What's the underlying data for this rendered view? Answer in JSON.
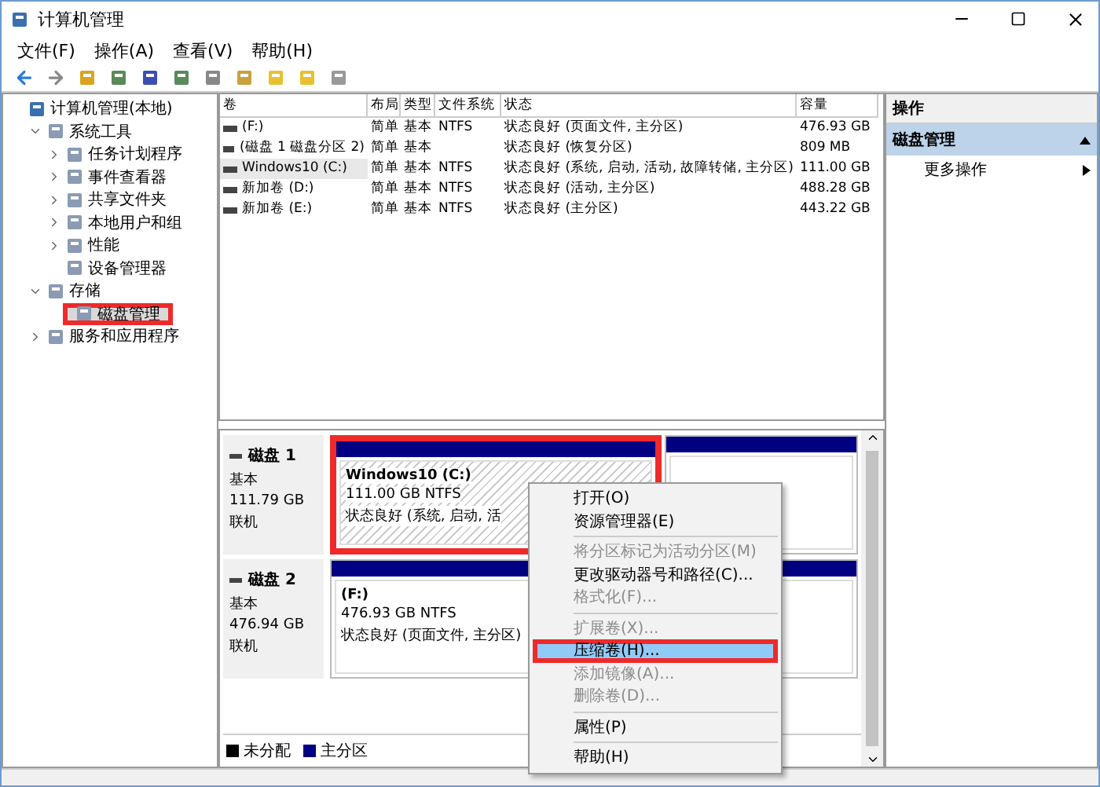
{
  "window": {
    "title": "计算机管理"
  },
  "menu_bar": [
    "文件(F)",
    "操作(A)",
    "查看(V)",
    "帮助(H)"
  ],
  "tree": [
    {
      "label": "计算机管理(本地)",
      "selected": false,
      "highlighted": false,
      "children": [
        {
          "label": "系统工具",
          "expanded": true,
          "selected": false,
          "highlighted": false,
          "children": [
            {
              "label": "任务计划程序",
              "expanded": false,
              "selected": false,
              "highlighted": false
            },
            {
              "label": "事件查看器",
              "expanded": false,
              "selected": false,
              "highlighted": false
            },
            {
              "label": "共享文件夹",
              "expanded": false,
              "selected": false,
              "highlighted": false
            },
            {
              "label": "本地用户和组",
              "expanded": false,
              "selected": false,
              "highlighted": false
            },
            {
              "label": "性能",
              "expanded": false,
              "selected": false,
              "highlighted": false
            },
            {
              "label": "设备管理器",
              "selected": false,
              "highlighted": false
            }
          ]
        },
        {
          "label": "存储",
          "expanded": true,
          "selected": false,
          "highlighted": false,
          "children": [
            {
              "label": "磁盘管理",
              "selected": true,
              "highlighted": true
            }
          ]
        },
        {
          "label": "服务和应用程序",
          "expanded": false,
          "selected": false,
          "highlighted": false
        }
      ]
    }
  ],
  "volume_table": {
    "columns": [
      "卷",
      "布局",
      "类型",
      "文件系统",
      "状态",
      "容量"
    ],
    "rows": [
      {
        "selected": false,
        "cells": [
          "(F:)",
          "简单",
          "基本",
          "NTFS",
          "状态良好 (页面文件, 主分区)",
          "476.93 GB"
        ]
      },
      {
        "selected": false,
        "cells": [
          "(磁盘 1 磁盘分区 2)",
          "简单",
          "基本",
          null,
          "状态良好 (恢复分区)",
          "809 MB"
        ]
      },
      {
        "selected": true,
        "cells": [
          "Windows10 (C:)",
          "简单",
          "基本",
          "NTFS",
          "状态良好 (系统, 启动, 活动, 故障转储, 主分区)",
          "111.00 GB"
        ]
      },
      {
        "selected": false,
        "cells": [
          "新加卷 (D:)",
          "简单",
          "基本",
          "NTFS",
          "状态良好 (活动, 主分区)",
          "488.28 GB"
        ]
      },
      {
        "selected": false,
        "cells": [
          "新加卷 (E:)",
          "简单",
          "基本",
          "NTFS",
          "状态良好 (主分区)",
          "443.22 GB"
        ]
      }
    ]
  },
  "disks": [
    {
      "name": "磁盘 1",
      "type": "基本",
      "size": "111.79 GB",
      "status": "联机",
      "partitions": [
        {
          "name": "Windows10  (C:)",
          "size_fs": "111.00 GB NTFS",
          "status": "状态良好 (系统, 启动, 活",
          "selected": true,
          "highlighted": true,
          "color": "#000080"
        },
        {
          "selected": false,
          "highlighted": false,
          "color": "#000080"
        }
      ]
    },
    {
      "name": "磁盘 2",
      "type": "基本",
      "size": "476.94 GB",
      "status": "联机",
      "partitions": [
        {
          "name": "(F:)",
          "size_fs": "476.93 GB NTFS",
          "status": "状态良好 (页面文件, 主分区)",
          "selected": false,
          "highlighted": false,
          "color": "#000080"
        }
      ]
    }
  ],
  "legend": [
    {
      "label": "未分配",
      "color": "#000000"
    },
    {
      "label": "主分区",
      "color": "#000080"
    }
  ],
  "actions": {
    "title": "操作",
    "section": "磁盘管理",
    "items": [
      "更多操作"
    ]
  },
  "context_menu": [
    {
      "kind": "item",
      "label": "打开(O)",
      "disabled": false,
      "selected": false,
      "highlighted": false
    },
    {
      "kind": "item",
      "label": "资源管理器(E)",
      "disabled": false,
      "selected": false,
      "highlighted": false
    },
    {
      "kind": "separator"
    },
    {
      "kind": "item",
      "label": "将分区标记为活动分区(M)",
      "disabled": true,
      "selected": false,
      "highlighted": false
    },
    {
      "kind": "item",
      "label": "更改驱动器号和路径(C)...",
      "disabled": false,
      "selected": false,
      "highlighted": false
    },
    {
      "kind": "item",
      "label": "格式化(F)...",
      "disabled": true,
      "selected": false,
      "highlighted": false
    },
    {
      "kind": "separator"
    },
    {
      "kind": "item",
      "label": "扩展卷(X)...",
      "disabled": true,
      "selected": false,
      "highlighted": false
    },
    {
      "kind": "item",
      "label": "压缩卷(H)...",
      "disabled": false,
      "selected": true,
      "highlighted": true
    },
    {
      "kind": "item",
      "label": "添加镜像(A)...",
      "disabled": true,
      "selected": false,
      "highlighted": false
    },
    {
      "kind": "item",
      "label": "删除卷(D)...",
      "disabled": true,
      "selected": false,
      "highlighted": false
    },
    {
      "kind": "separator"
    },
    {
      "kind": "item",
      "label": "属性(P)",
      "disabled": false,
      "selected": false,
      "highlighted": false
    },
    {
      "kind": "separator"
    },
    {
      "kind": "item",
      "label": "帮助(H)",
      "disabled": false,
      "selected": false,
      "highlighted": false
    }
  ]
}
